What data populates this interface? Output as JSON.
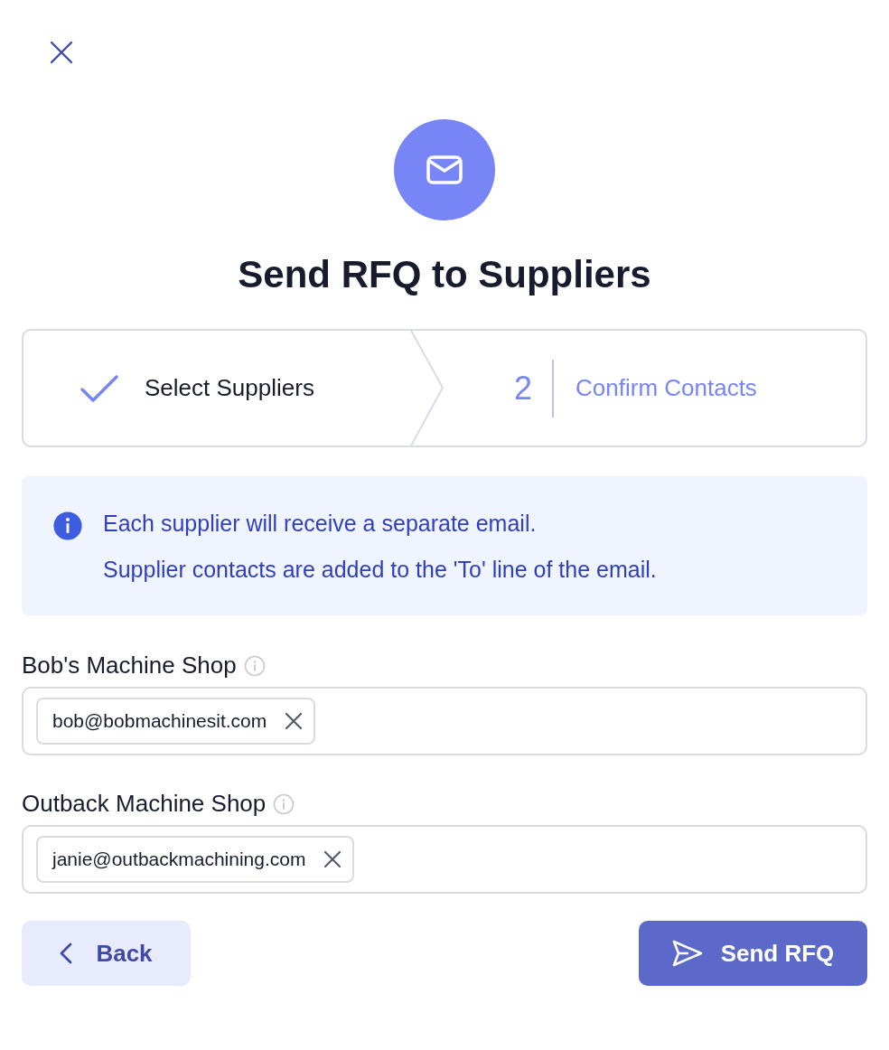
{
  "title": "Send RFQ to Suppliers",
  "steps": [
    {
      "label": "Select Suppliers",
      "completed": true,
      "selected": false
    },
    {
      "number": "2",
      "label": "Confirm Contacts",
      "completed": false,
      "selected": true
    }
  ],
  "notice": {
    "lines": [
      "Each supplier will receive a separate email.",
      "Supplier contacts are added to the 'To' line of the email."
    ]
  },
  "suppliers": [
    {
      "name": "Bob's Machine Shop",
      "contacts": [
        "bob@bobmachinesit.com"
      ]
    },
    {
      "name": "Outback Machine Shop",
      "contacts": [
        "janie@outbackmachining.com"
      ]
    }
  ],
  "buttons": {
    "back": "Back",
    "send": "Send RFQ"
  }
}
